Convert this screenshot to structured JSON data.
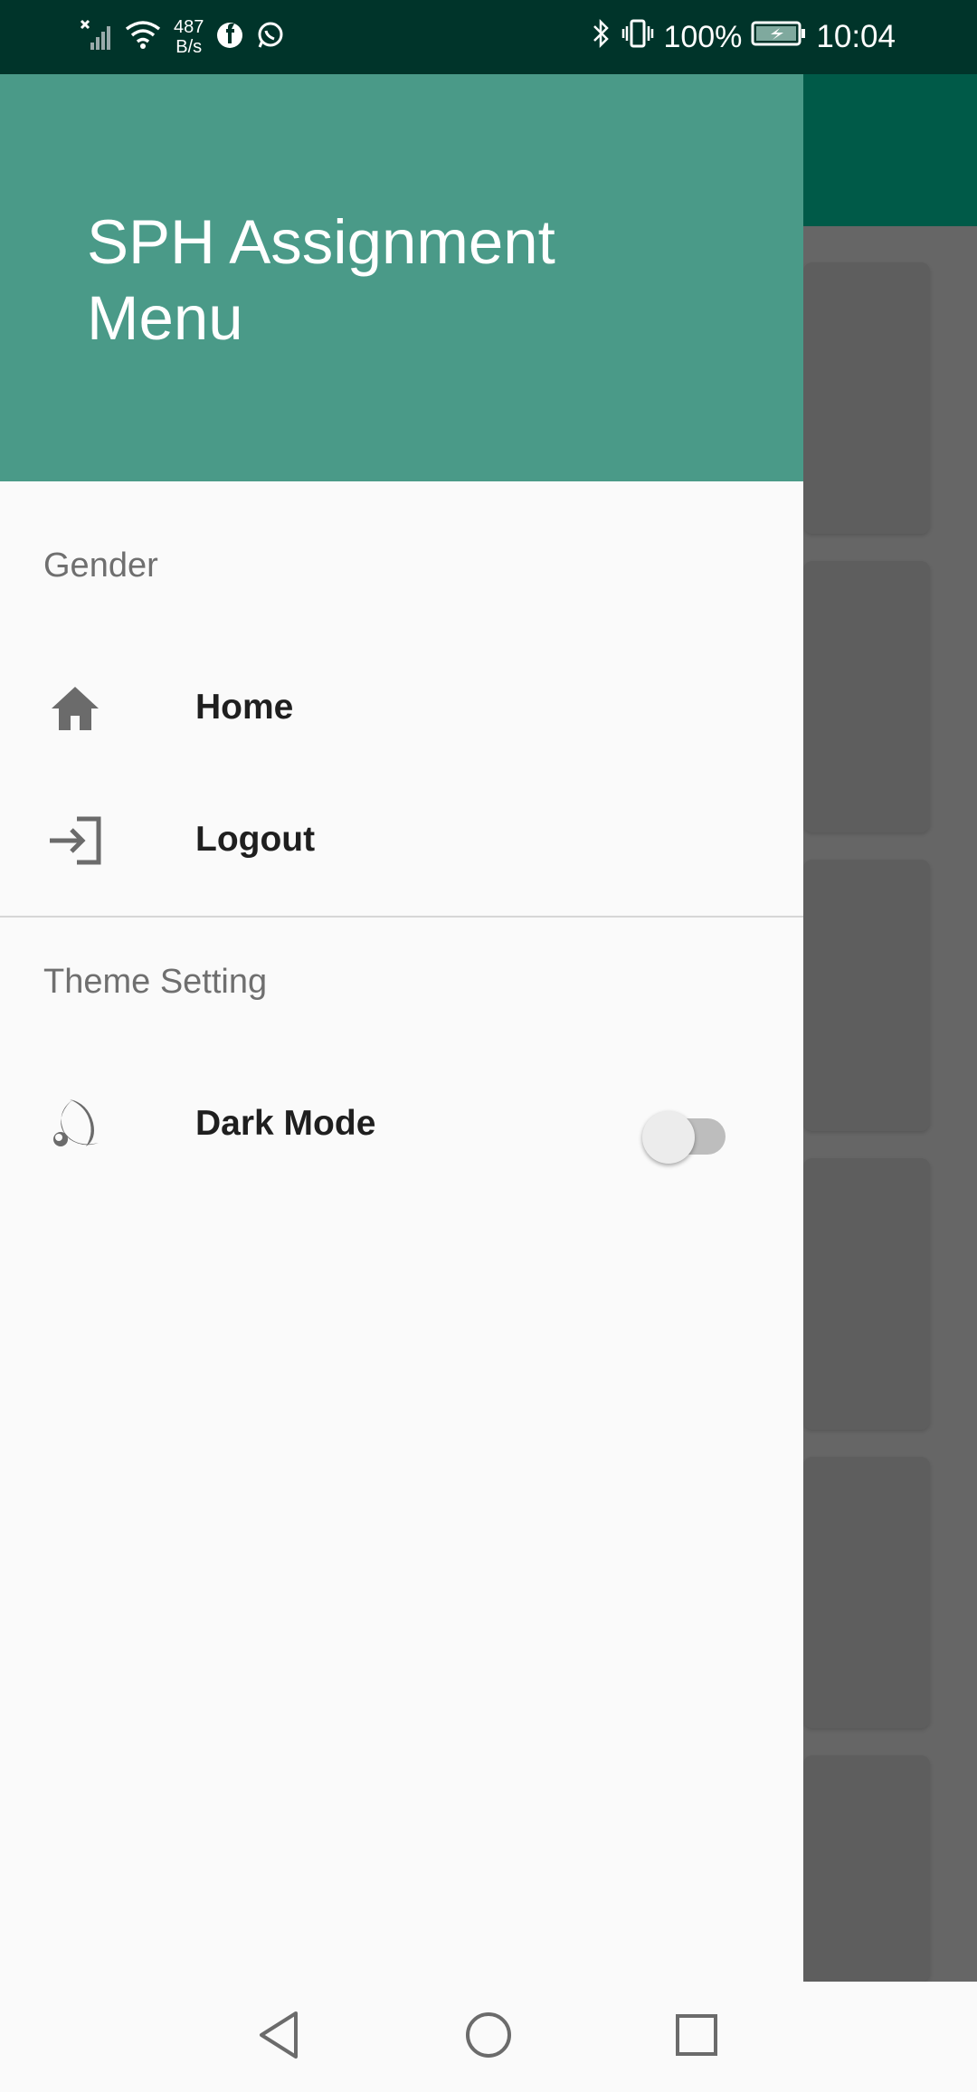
{
  "status_bar": {
    "network_speed_value": "487",
    "network_speed_unit": "B/s",
    "battery_percent": "100%",
    "time": "10:04",
    "left_icons": [
      "signal-off-icon",
      "wifi-icon",
      "facebook-icon",
      "whatsapp-icon"
    ],
    "right_icons": [
      "bluetooth-icon",
      "vibrate-icon",
      "battery-charging-icon"
    ]
  },
  "drawer": {
    "header_title": "SPH Assignment Menu",
    "header_color": "#4a9a88",
    "sections": [
      {
        "label": "Gender",
        "items": [
          {
            "label": "Home",
            "icon": "home-icon"
          },
          {
            "label": "Logout",
            "icon": "login-icon"
          }
        ]
      },
      {
        "label": "Theme Setting",
        "items": [
          {
            "label": "Dark Mode",
            "icon": "moon-icon",
            "toggle": false
          }
        ]
      }
    ]
  },
  "background_app": {
    "appbar_color": "#005a48",
    "scrim": true
  },
  "nav_bar": {
    "buttons": [
      "back-icon",
      "home-circle-icon",
      "recents-icon"
    ]
  }
}
